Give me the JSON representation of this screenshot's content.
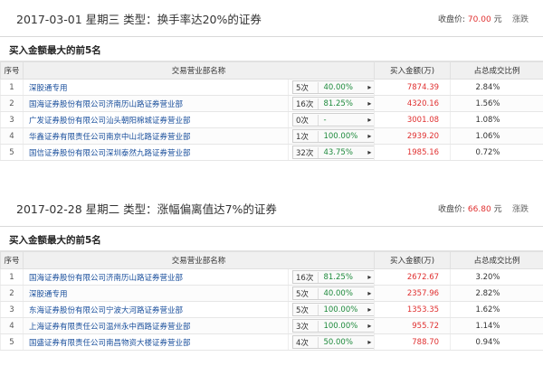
{
  "colors": {
    "accent_red": "#e03030",
    "broker_blue": "#1a4f9c",
    "pct_green": "#1e8a3c"
  },
  "headers": {
    "idx": "序号",
    "broker": "交易营业部名称",
    "amount": "买入金额(万)",
    "ratio": "占总成交比例"
  },
  "panels": [
    {
      "title": "2017-03-01  星期三   类型：换手率达20%的证券",
      "close_label": "收盘价:",
      "close_value": "70.00",
      "close_unit": "元",
      "more": "涨跌",
      "subtitle": "买入金额最大的前5名",
      "rows": [
        {
          "idx": "1",
          "broker": "深股通专用",
          "count": "5次",
          "pct": "40.00%",
          "amount": "7874.39",
          "ratio": "2.84%",
          "has_help_icon": true
        },
        {
          "idx": "2",
          "broker": "国海证券股份有限公司济南历山路证券营业部",
          "count": "16次",
          "pct": "81.25%",
          "amount": "4320.16",
          "ratio": "1.56%"
        },
        {
          "idx": "3",
          "broker": "广发证券股份有限公司汕头朝阳棉城证券营业部",
          "count": "0次",
          "pct": "-",
          "amount": "3001.08",
          "ratio": "1.08%"
        },
        {
          "idx": "4",
          "broker": "华鑫证券有限责任公司南京中山北路证券营业部",
          "count": "1次",
          "pct": "100.00%",
          "amount": "2939.20",
          "ratio": "1.06%"
        },
        {
          "idx": "5",
          "broker": "国信证券股份有限公司深圳泰然九路证券营业部",
          "count": "32次",
          "pct": "43.75%",
          "amount": "1985.16",
          "ratio": "0.72%"
        }
      ]
    },
    {
      "title": "2017-02-28  星期二   类型：涨幅偏离值达7%的证券",
      "close_label": "收盘价:",
      "close_value": "66.80",
      "close_unit": "元",
      "more": "涨跌",
      "subtitle": "买入金额最大的前5名",
      "rows": [
        {
          "idx": "1",
          "broker": "国海证券股份有限公司济南历山路证券营业部",
          "count": "16次",
          "pct": "81.25%",
          "amount": "2672.67",
          "ratio": "3.20%"
        },
        {
          "idx": "2",
          "broker": "深股通专用",
          "count": "5次",
          "pct": "40.00%",
          "amount": "2357.96",
          "ratio": "2.82%"
        },
        {
          "idx": "3",
          "broker": "东海证券股份有限公司宁波大河路证券营业部",
          "count": "5次",
          "pct": "100.00%",
          "amount": "1353.35",
          "ratio": "1.62%"
        },
        {
          "idx": "4",
          "broker": "上海证券有限责任公司温州永中西路证券营业部",
          "count": "3次",
          "pct": "100.00%",
          "amount": "955.72",
          "ratio": "1.14%"
        },
        {
          "idx": "5",
          "broker": "国盛证券有限责任公司南昌物资大楼证券营业部",
          "count": "4次",
          "pct": "50.00%",
          "amount": "788.70",
          "ratio": "0.94%"
        }
      ]
    }
  ]
}
